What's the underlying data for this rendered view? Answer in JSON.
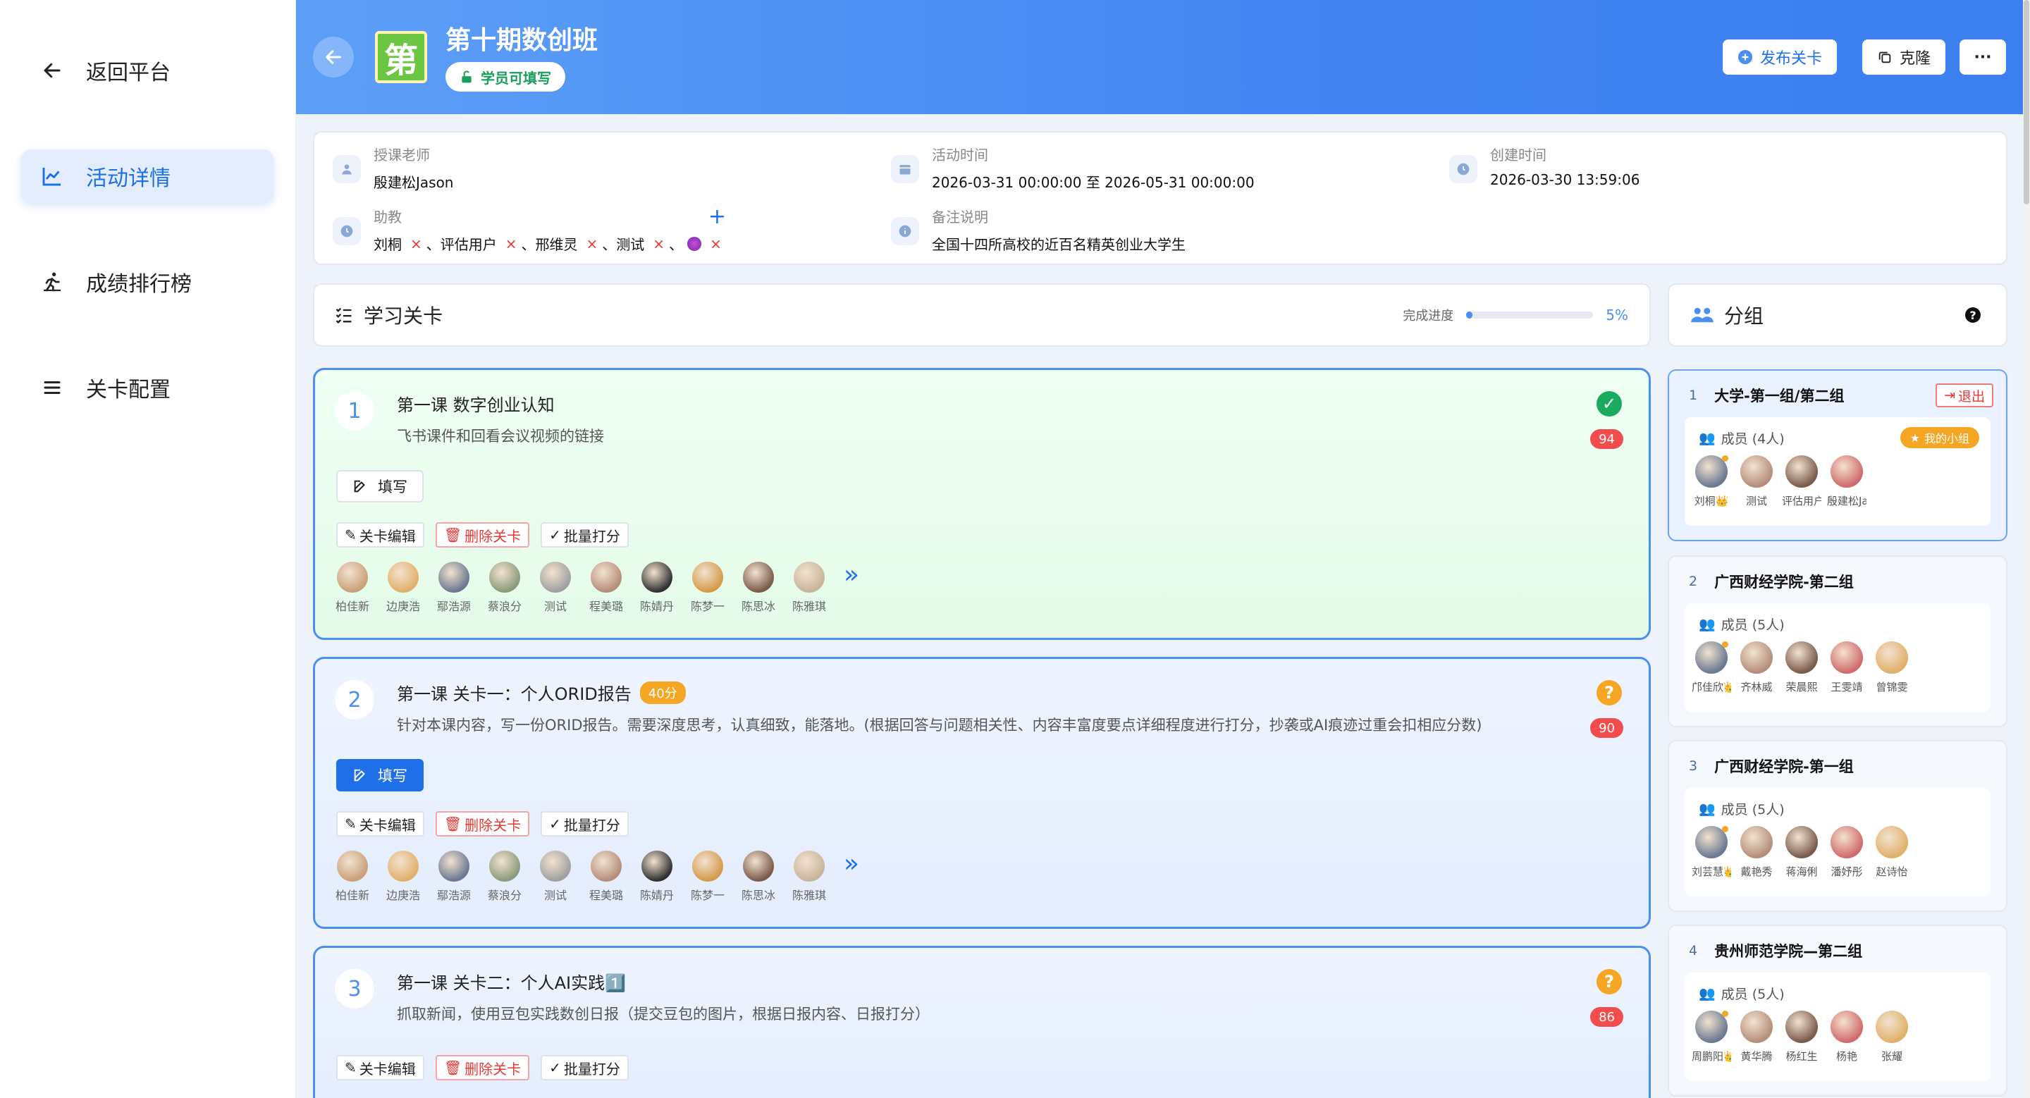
{
  "sidebar": {
    "back": "返回平台",
    "items": [
      {
        "label": "活动详情",
        "active": true
      },
      {
        "label": "成绩排行榜",
        "active": false
      },
      {
        "label": "关卡配置",
        "active": false
      }
    ]
  },
  "header": {
    "logo_char": "第",
    "title": "第十期数创班",
    "badge": "学员可填写",
    "publish_label": "发布关卡",
    "clone_label": "克隆",
    "more_label": "···"
  },
  "info": {
    "teacher_label": "授课老师",
    "teacher": "殷建松Jason",
    "time_label": "活动时间",
    "time": "2026-03-31 00:00:00 至 2026-05-31 00:00:00",
    "created_label": "创建时间",
    "created": "2026-03-30 13:59:06",
    "assistant_label": "助教",
    "assistants": [
      "刘桐",
      "评估用户",
      "邢维灵",
      "测试"
    ],
    "assistant_add": "+",
    "note_label": "备注说明",
    "note": "全国十四所高校的近百名精英创业大学生"
  },
  "levels_section": {
    "title": "学习关卡",
    "progress_label": "完成进度",
    "progress_value": "5%",
    "progress_fraction": 0.05
  },
  "groups_section": {
    "title": "分组",
    "help": "?"
  },
  "level_actions": {
    "edit": "关卡编辑",
    "delete": "删除关卡",
    "batch": "批量打分",
    "fill": "填写"
  },
  "student_names": [
    "柏佳新",
    "边庚浩",
    "鄢浩源",
    "蔡浪分",
    "测试",
    "程美璐",
    "陈婧丹",
    "陈梦一",
    "陈思冰",
    "陈雅琪"
  ],
  "levels": [
    {
      "num": "1",
      "title": "第一课 数字创业认知",
      "score": "",
      "desc": "飞书课件和回看会议视频的链接",
      "count": "94",
      "status": "done"
    },
    {
      "num": "2",
      "title": "第一课 关卡一：个人ORID报告",
      "score": "40分",
      "desc": "针对本课内容，写一份ORID报告。需要深度思考，认真细致，能落地。(根据回答与问题相关性、内容丰富度要点详细程度进行打分，抄袭或AI痕迹过重会扣相应分数)",
      "count": "90",
      "status": "pending"
    },
    {
      "num": "3",
      "title": "第一课 关卡二：个人AI实践1️⃣",
      "score": "",
      "desc": "抓取新闻，使用豆包实践数创日报（提交豆包的图片，根据日报内容、日报打分）",
      "count": "86",
      "status": "pending"
    }
  ],
  "groups": [
    {
      "idx": "1",
      "name": "大学-第一组/第二组",
      "members": "成员 (4人)",
      "exit": "退出",
      "mine": "我的小组",
      "names": [
        "刘桐👑",
        "测试",
        "评估用户",
        "殷建松Jason"
      ]
    },
    {
      "idx": "2",
      "name": "广西财经学院-第二组",
      "members": "成员 (5人)",
      "names": [
        "邝佳欣👑",
        "齐林威",
        "荣晨熙",
        "王雯靖",
        "曾锦雯"
      ]
    },
    {
      "idx": "3",
      "name": "广西财经学院-第一组",
      "members": "成员 (5人)",
      "names": [
        "刘芸慧👑",
        "戴艳秀",
        "蒋海俐",
        "潘妤彤",
        "赵诗怡"
      ]
    },
    {
      "idx": "4",
      "name": "贵州师范学院—第二组",
      "members": "成员 (5人)",
      "names": [
        "周鹏阳👑",
        "黄华腾",
        "杨红生",
        "杨艳",
        "张耀"
      ]
    }
  ],
  "colors": {
    "accent": "#1e6fe8",
    "header_start": "#5d9ff7",
    "header_end": "#3b7ff0",
    "done_green": "#1aab5f",
    "pending_orange": "#f5a623",
    "danger": "#e53935"
  }
}
